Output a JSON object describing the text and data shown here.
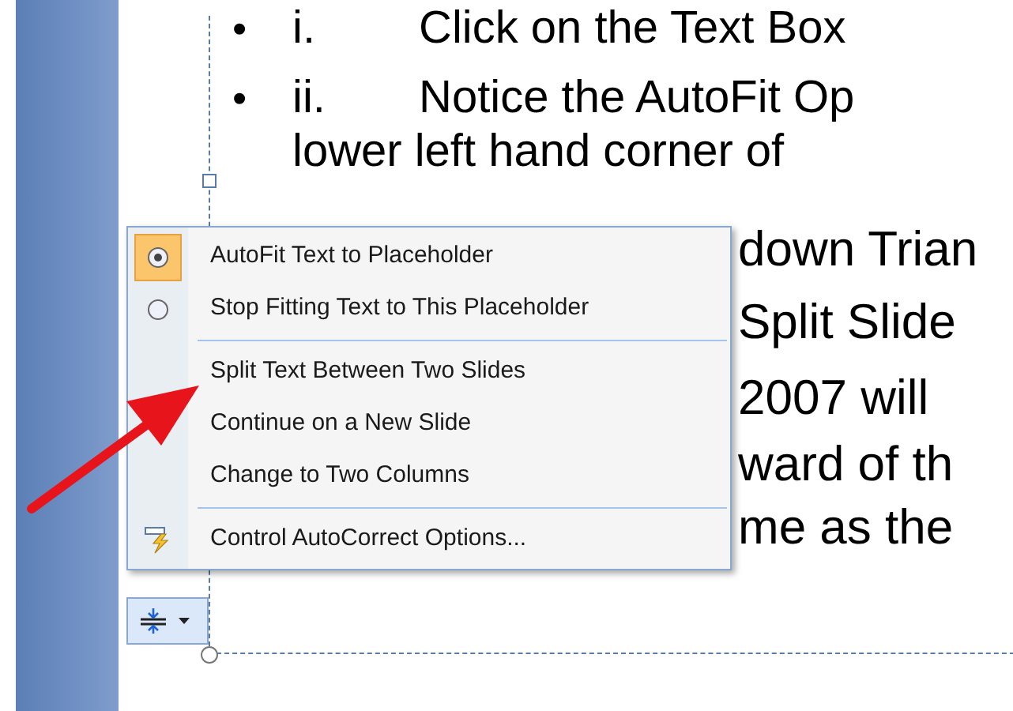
{
  "slide": {
    "lines": [
      {
        "bullet": "•",
        "number": "i.",
        "text": "Click on the Text Box"
      },
      {
        "bullet": "•",
        "number": "ii.",
        "text": "Notice the AutoFit Op",
        "continuation": "lower left hand corner of"
      }
    ],
    "fragments": [
      "down Trian",
      "Split Slide",
      "2007 will",
      "ward of th",
      "me as the"
    ]
  },
  "menu": {
    "items": [
      {
        "kind": "radio",
        "label": "AutoFit Text to Placeholder",
        "selected": true,
        "separator_before": false
      },
      {
        "kind": "radio",
        "label": "Stop Fitting Text to This Placeholder",
        "selected": false,
        "separator_before": false
      },
      {
        "kind": "plain",
        "label": "Split Text Between Two Slides",
        "separator_before": true
      },
      {
        "kind": "plain",
        "label": "Continue on a New Slide",
        "separator_before": false
      },
      {
        "kind": "plain",
        "label": "Change to Two Columns",
        "separator_before": false
      },
      {
        "kind": "autocorrect",
        "label": "Control AutoCorrect Options...",
        "separator_before": true
      }
    ]
  }
}
